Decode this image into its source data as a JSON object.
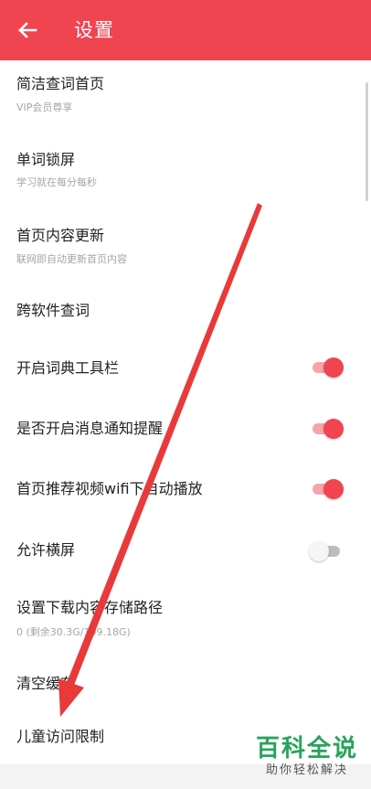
{
  "appbar": {
    "title": "设置",
    "back_icon": "arrow-left-icon",
    "color": "#f04450"
  },
  "settings": [
    {
      "title": "简洁查词首页",
      "subtitle": "VIP会员尊享"
    },
    {
      "title": "单词锁屏",
      "subtitle": "学习就在每分每秒"
    },
    {
      "title": "首页内容更新",
      "subtitle": "联网即自动更新首页内容"
    },
    {
      "title": "跨软件查词"
    },
    {
      "title": "开启词典工具栏",
      "toggle": "on"
    },
    {
      "title": "是否开启消息通知提醒",
      "toggle": "on"
    },
    {
      "title": "首页推荐视频wifi下自动播放",
      "toggle": "on"
    },
    {
      "title": "允许横屏",
      "toggle": "off"
    },
    {
      "title": "设置下载内容存储路径",
      "subtitle": "0 (剩余30.3G/109.18G)"
    },
    {
      "title": "清空缓存"
    },
    {
      "title": "儿童访问限制"
    }
  ],
  "watermark": {
    "main": "百科全说",
    "sub": "助你轻松解决"
  }
}
